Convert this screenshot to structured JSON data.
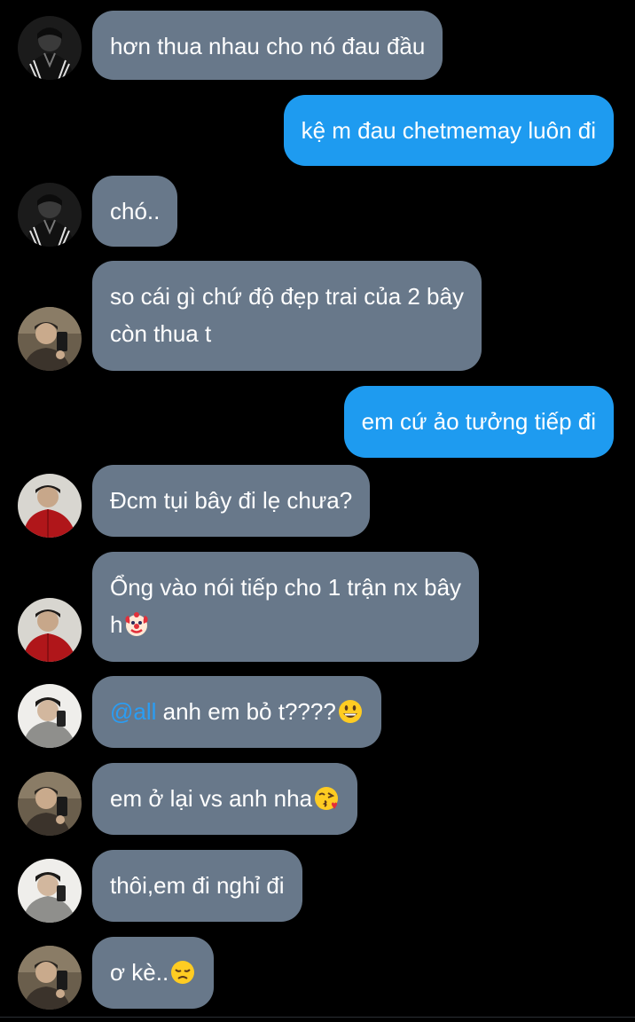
{
  "messages": [
    {
      "sender": "user-dark-jacket",
      "text": "hơn thua nhau cho nó đau đầu"
    },
    {
      "sender": "me",
      "text": "kệ m đau chetmemay luôn đi"
    },
    {
      "sender": "user-dark-jacket",
      "text": "chó.."
    },
    {
      "sender": "user-mirror-selfie",
      "line1": "so cái gì chứ độ đẹp trai của 2 bây",
      "line2": "còn thua t"
    },
    {
      "sender": "me",
      "text": "em cứ ảo tưởng tiếp đi"
    },
    {
      "sender": "user-red-hoodie",
      "text": "Đcm tụi bây đi lẹ chưa?"
    },
    {
      "sender": "user-red-hoodie",
      "line1": "Ổng vào nói tiếp cho 1 trận nx bây",
      "line2": "h",
      "emoji": "clown-face-emoji"
    },
    {
      "sender": "user-grey-hoodie",
      "mention": "@all",
      "text": " anh em bỏ t????",
      "emoji": "grinning-face-emoji"
    },
    {
      "sender": "user-mirror-selfie",
      "text": "em ở lại vs anh nha",
      "emoji": "face-blowing-kiss-emoji"
    },
    {
      "sender": "user-grey-hoodie",
      "text": "thôi,em đi nghỉ đi"
    },
    {
      "sender": "user-mirror-selfie",
      "text": "ơ kè..",
      "emoji": "disappointed-face-emoji"
    }
  ],
  "colors": {
    "background": "#000000",
    "incoming_bubble": "#68788a",
    "outgoing_bubble": "#1e9bf0",
    "mention": "#2a9df4",
    "text": "#ffffff"
  }
}
